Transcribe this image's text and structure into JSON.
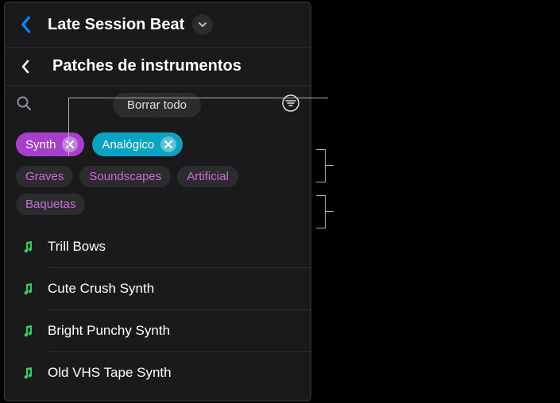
{
  "topbar": {
    "project_title": "Late Session Beat"
  },
  "subheader": {
    "title": "Patches de instrumentos"
  },
  "filter_bar": {
    "clear_label": "Borrar todo"
  },
  "active_filters": [
    {
      "label": "Synth",
      "color": "purple"
    },
    {
      "label": "Analógico",
      "color": "teal"
    }
  ],
  "suggestions": [
    {
      "label": "Graves"
    },
    {
      "label": "Soundscapes"
    },
    {
      "label": "Artificial"
    },
    {
      "label": "Baquetas"
    }
  ],
  "patches": [
    {
      "name": "Trill Bows"
    },
    {
      "name": "Cute Crush Synth"
    },
    {
      "name": "Bright Punchy Synth"
    },
    {
      "name": "Old VHS Tape Synth"
    }
  ]
}
